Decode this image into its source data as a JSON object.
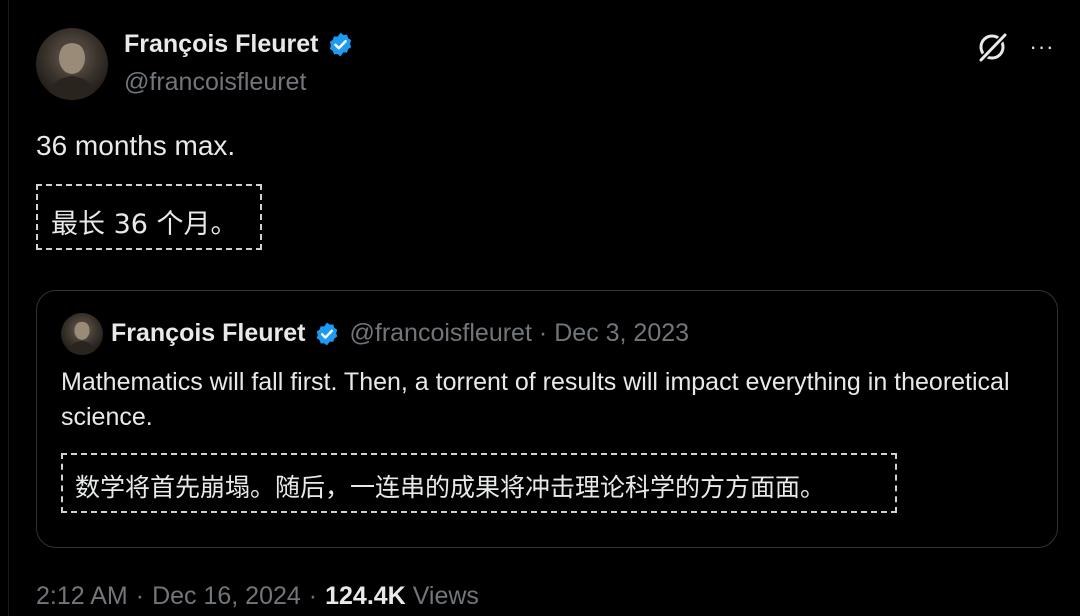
{
  "tweet": {
    "author": {
      "name": "François Fleuret",
      "handle": "@francoisfleuret",
      "avatar_icon": "user-avatar",
      "verified_icon": "verified-badge-icon"
    },
    "text": "36 months max.",
    "translation": "最长 36 个月。",
    "actions": {
      "grok_icon": "grok-icon",
      "more_label": "···"
    },
    "quote": {
      "author_name": "François Fleuret",
      "handle": "@francoisfleuret",
      "separator": "·",
      "date": "Dec 3, 2023",
      "text": "Mathematics will fall first. Then, a torrent of results will impact everything in theoretical science.",
      "translation": "数学将首先崩塌。随后，一连串的成果将冲击理论科学的方方面面。"
    },
    "meta": {
      "time": "2:12 AM",
      "separator": "·",
      "date": "Dec 16, 2024",
      "views_count": "124.4K",
      "views_label": "Views"
    }
  },
  "colors": {
    "background": "#000000",
    "text_primary": "#e7e9ea",
    "text_secondary": "#71767b",
    "verified_blue": "#1d9bf0",
    "card_border": "#2f3336"
  }
}
